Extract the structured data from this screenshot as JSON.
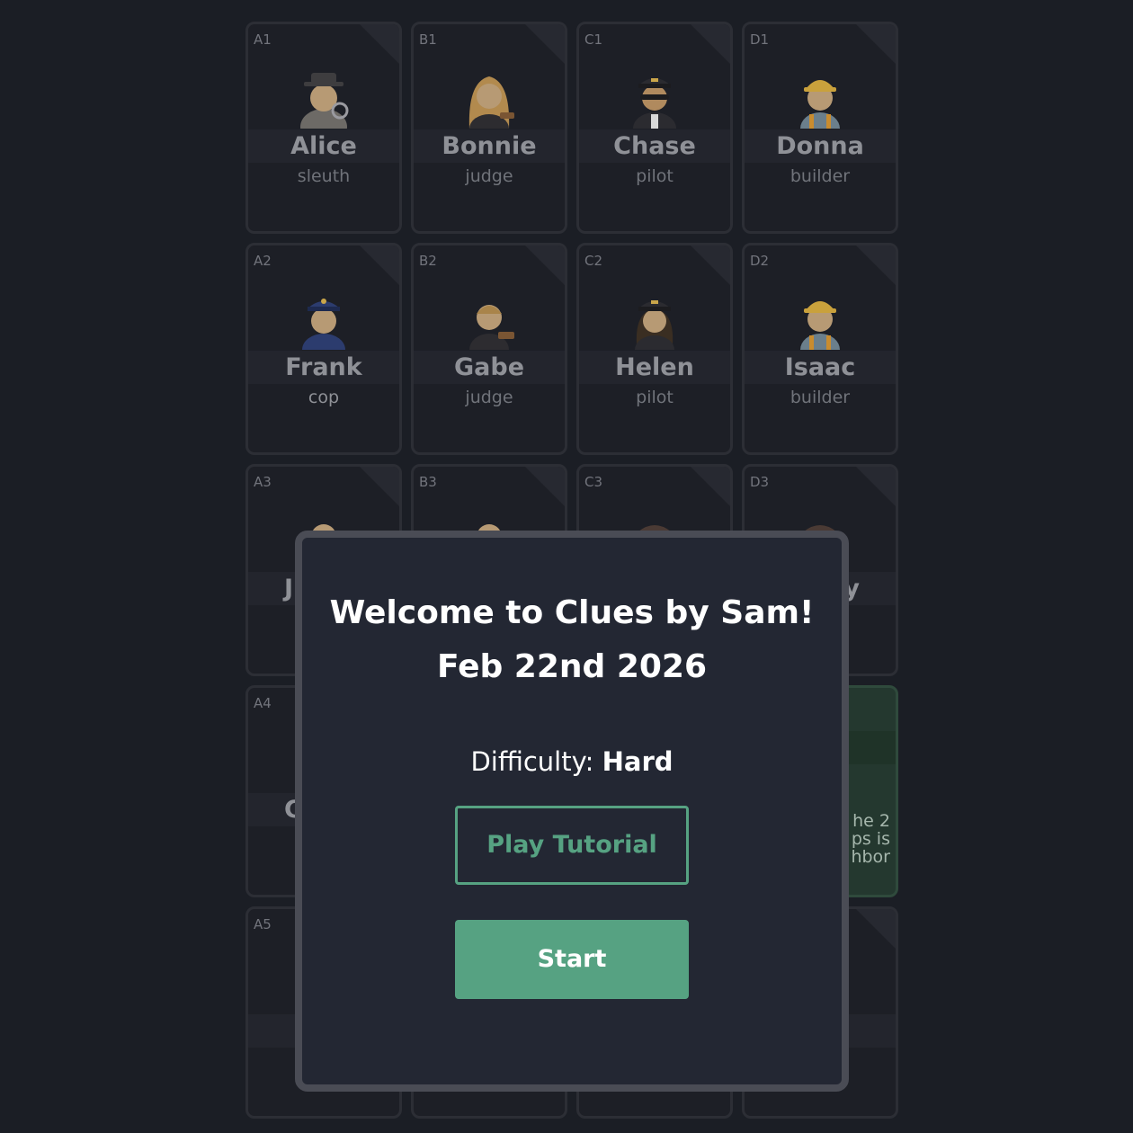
{
  "colors": {
    "accent": "#56a282",
    "modal_border": "#4a4c55",
    "background": "#1b1e25"
  },
  "board": {
    "cards": [
      {
        "coord": "A1",
        "name": "Alice",
        "role": "sleuth",
        "icon": "detective-woman-icon"
      },
      {
        "coord": "B1",
        "name": "Bonnie",
        "role": "judge",
        "icon": "judge-woman-icon"
      },
      {
        "coord": "C1",
        "name": "Chase",
        "role": "pilot",
        "icon": "pilot-man-icon"
      },
      {
        "coord": "D1",
        "name": "Donna",
        "role": "builder",
        "icon": "builder-woman-icon"
      },
      {
        "coord": "A2",
        "name": "Frank",
        "role": "cop",
        "icon": "police-man-icon"
      },
      {
        "coord": "B2",
        "name": "Gabe",
        "role": "judge",
        "icon": "judge-man-icon"
      },
      {
        "coord": "C2",
        "name": "Helen",
        "role": "pilot",
        "icon": "pilot-woman-icon"
      },
      {
        "coord": "D2",
        "name": "Isaac",
        "role": "builder",
        "icon": "builder-man-icon"
      },
      {
        "coord": "A3",
        "name": "J",
        "role": "",
        "icon": "person-icon"
      },
      {
        "coord": "B3",
        "name": "",
        "role": "",
        "icon": "person-icon"
      },
      {
        "coord": "C3",
        "name": "",
        "role": "",
        "icon": "person-icon"
      },
      {
        "coord": "D3",
        "name": "y",
        "role": "",
        "icon": "person-icon"
      },
      {
        "coord": "A4",
        "name": "C",
        "role": "",
        "icon": "person-icon"
      },
      {
        "coord": "",
        "name": "",
        "role": "",
        "icon": ""
      },
      {
        "coord": "",
        "name": "",
        "role": "",
        "icon": ""
      },
      {
        "coord": "",
        "name": "",
        "role": "",
        "icon": "",
        "hint": "he 2\nps is\nhbor"
      },
      {
        "coord": "A5",
        "name": "",
        "role": "",
        "icon": ""
      },
      {
        "coord": "",
        "name": "",
        "role": "",
        "icon": ""
      },
      {
        "coord": "",
        "name": "",
        "role": "",
        "icon": ""
      },
      {
        "coord": "",
        "name": "",
        "role": "",
        "icon": ""
      }
    ]
  },
  "modal": {
    "title_line1": "Welcome to Clues by Sam!",
    "title_line2": "Feb 22nd 2026",
    "difficulty_label": "Difficulty:",
    "difficulty_value": "Hard",
    "tutorial_button": "Play Tutorial",
    "start_button": "Start"
  }
}
